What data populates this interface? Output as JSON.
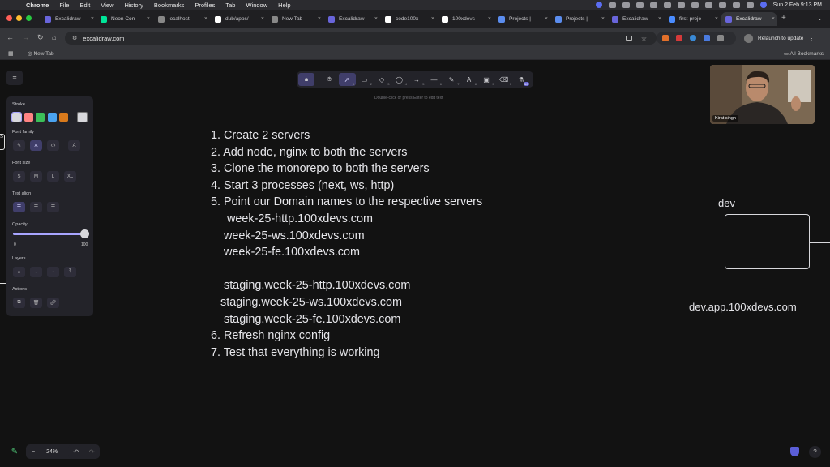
{
  "menubar": {
    "app": "Chrome",
    "items": [
      "File",
      "Edit",
      "View",
      "History",
      "Bookmarks",
      "Profiles",
      "Tab",
      "Window",
      "Help"
    ],
    "clock": "Sun 2 Feb  9:13 PM"
  },
  "tabs": [
    {
      "label": "Excalidraw",
      "icon": "excalidraw-icon",
      "color": "#6965db"
    },
    {
      "label": "Neon Con",
      "icon": "neon-icon",
      "color": "#00e599"
    },
    {
      "label": "localhost",
      "icon": "globe-icon",
      "color": "#888888"
    },
    {
      "label": "dub/apps/",
      "icon": "github-icon",
      "color": "#ffffff"
    },
    {
      "label": "New Tab",
      "icon": "chrome-icon",
      "color": "#888888"
    },
    {
      "label": "Excalidraw",
      "icon": "excalidraw-icon",
      "color": "#6965db"
    },
    {
      "label": "code100x",
      "icon": "github-icon",
      "color": "#ffffff"
    },
    {
      "label": "100xdevs",
      "icon": "github-icon",
      "color": "#ffffff"
    },
    {
      "label": "Projects |",
      "icon": "projects-icon",
      "color": "#5b8def"
    },
    {
      "label": "Projects |",
      "icon": "projects-icon",
      "color": "#5b8def"
    },
    {
      "label": "Excalidraw",
      "icon": "excalidraw-icon",
      "color": "#6965db"
    },
    {
      "label": "first-proje",
      "icon": "loading-icon",
      "color": "#4a8cff"
    },
    {
      "label": "Excalidraw",
      "icon": "excalidraw-icon",
      "color": "#6965db"
    }
  ],
  "address": {
    "url": "excalidraw.com"
  },
  "relaunch": {
    "label": "Relaunch to update"
  },
  "bookmarks": {
    "new_tab": "New Tab",
    "all": "All Bookmarks"
  },
  "toolbar": {
    "tools": [
      {
        "name": "lock-tool",
        "glyph": "🔒︎",
        "kbd": ""
      },
      {
        "name": "hand-tool",
        "glyph": "✋︎",
        "kbd": ""
      },
      {
        "name": "selection-tool",
        "glyph": "➚",
        "kbd": "1"
      },
      {
        "name": "rectangle-tool",
        "glyph": "▭",
        "kbd": "2"
      },
      {
        "name": "diamond-tool",
        "glyph": "◇",
        "kbd": "3"
      },
      {
        "name": "ellipse-tool",
        "glyph": "◯",
        "kbd": "4"
      },
      {
        "name": "arrow-tool",
        "glyph": "→",
        "kbd": "5"
      },
      {
        "name": "line-tool",
        "glyph": "—",
        "kbd": "6"
      },
      {
        "name": "draw-tool",
        "glyph": "✎",
        "kbd": "7"
      },
      {
        "name": "text-tool",
        "glyph": "A",
        "kbd": "8"
      },
      {
        "name": "image-tool",
        "glyph": "▣",
        "kbd": "9"
      },
      {
        "name": "eraser-tool",
        "glyph": "⌫",
        "kbd": "0"
      },
      {
        "name": "library-tool",
        "glyph": "⚗",
        "kbd": "50"
      }
    ],
    "hint": "Double-click or press Enter to edit text"
  },
  "properties": {
    "stroke_label": "Stroke",
    "stroke_colors": [
      "#d8d8dc",
      "#ff8383",
      "#3bbf58",
      "#4aa3f0",
      "#d97a1c"
    ],
    "current_stroke": "#d8d8dc",
    "font_family_label": "Font family",
    "font_size_label": "Font size",
    "font_sizes": [
      "S",
      "M",
      "L",
      "XL"
    ],
    "text_align_label": "Text align",
    "opacity_label": "Opacity",
    "opacity_min": "0",
    "opacity_max": "100",
    "opacity_value": 100,
    "layers_label": "Layers",
    "actions_label": "Actions"
  },
  "canvas": {
    "notes": [
      "1. Create 2 servers",
      "2. Add node, nginx to both the servers",
      "3. Clone the monorepo to both the servers",
      "4. Start 3 processes (next, ws, http)",
      "5. Point our Domain names to the respective servers",
      "     week-25-http.100xdevs.com",
      "    week-25-ws.100xdevs.com",
      "    week-25-fe.100xdevs.com",
      "",
      "    staging.week-25-http.100xdevs.com",
      "   staging.week-25-ws.100xdevs.com",
      "    staging.week-25-fe.100xdevs.com",
      "6. Refresh nginx config",
      "7. Test that everything is working"
    ],
    "dev_label": "dev",
    "dev_domain": "dev.app.100xdevs.com"
  },
  "video": {
    "name": "Kirat singh"
  },
  "footer": {
    "zoom": "24%",
    "zoom_out": "−",
    "zoom_in": "+",
    "undo": "↶",
    "redo": "↷",
    "help": "?"
  }
}
